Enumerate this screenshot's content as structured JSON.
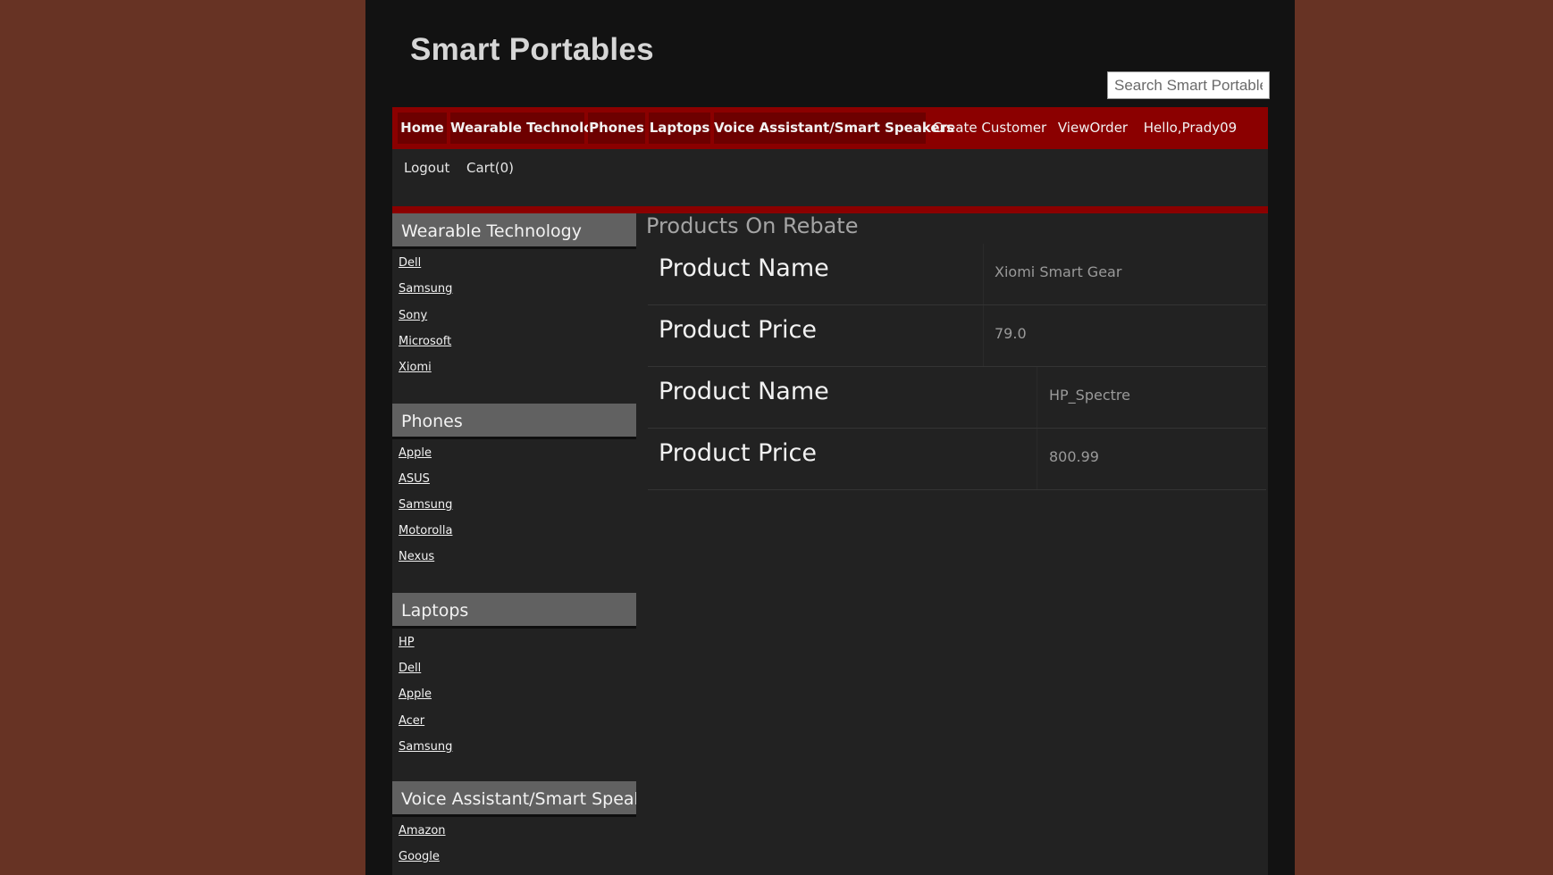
{
  "site": {
    "title": "Smart Portables"
  },
  "search": {
    "placeholder": "Search Smart Portables"
  },
  "nav": {
    "items": [
      {
        "label": "Home"
      },
      {
        "label": "Wearable Technology"
      },
      {
        "label": "Phones"
      },
      {
        "label": "Laptops"
      },
      {
        "label": "Voice Assistant/Smart Speakers"
      },
      {
        "label": "Create Customer"
      },
      {
        "label": "ViewOrder"
      },
      {
        "label": "Hello,Prady09"
      },
      {
        "label": "Logout"
      },
      {
        "label": "Cart(0)"
      }
    ]
  },
  "sidebar": {
    "sections": [
      {
        "title": "Wearable Technology",
        "links": [
          "Dell",
          "Samsung",
          "Sony",
          "Microsoft",
          "Xiomi"
        ]
      },
      {
        "title": "Phones",
        "links": [
          "Apple",
          "ASUS",
          "Samsung",
          "Motorolla",
          "Nexus"
        ]
      },
      {
        "title": "Laptops",
        "links": [
          "HP",
          "Dell",
          "Apple",
          "Acer",
          "Samsung"
        ]
      },
      {
        "title": "Voice Assistant/Smart Speaker",
        "links": [
          "Amazon",
          "Google"
        ]
      }
    ]
  },
  "content": {
    "title": "Products On Rebate",
    "rows": [
      {
        "label": "Product Name",
        "value": "Xiomi Smart Gear"
      },
      {
        "label": "Product Price",
        "value": "79.0"
      },
      {
        "label": "Product Name",
        "value": "HP_Spectre"
      },
      {
        "label": "Product Price",
        "value": "800.99"
      }
    ]
  }
}
